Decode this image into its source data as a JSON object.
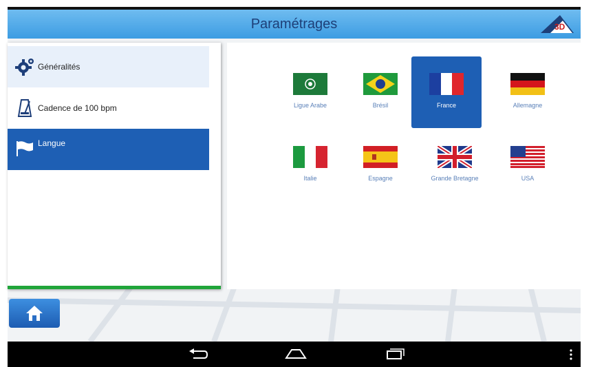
{
  "header": {
    "title": "Paramétrages",
    "logo_icon": "app-logo-triangle"
  },
  "menu": {
    "items": [
      {
        "label": "Généralités",
        "icon": "gear-icon"
      },
      {
        "label": "Cadence de 100 bpm",
        "icon": "metronome-icon"
      },
      {
        "label": "Langue",
        "icon": "flag-icon",
        "selected": true
      }
    ]
  },
  "languages": [
    {
      "label": "Ligue Arabe",
      "selected": false
    },
    {
      "label": "Brésil",
      "selected": false
    },
    {
      "label": "France",
      "selected": true
    },
    {
      "label": "Allemagne",
      "selected": false
    },
    {
      "label": "Italie",
      "selected": false
    },
    {
      "label": "Espagne",
      "selected": false
    },
    {
      "label": "Grande Bretagne",
      "selected": false
    },
    {
      "label": "USA",
      "selected": false
    }
  ],
  "home": {
    "icon": "home-icon"
  },
  "navbar": {
    "icons": [
      "back-icon",
      "home-nav-icon",
      "recents-icon",
      "overflow-icon"
    ]
  },
  "colors": {
    "header": "#3c9ce2",
    "selected": "#1e5fb4",
    "accent_green": "#20a53a"
  }
}
